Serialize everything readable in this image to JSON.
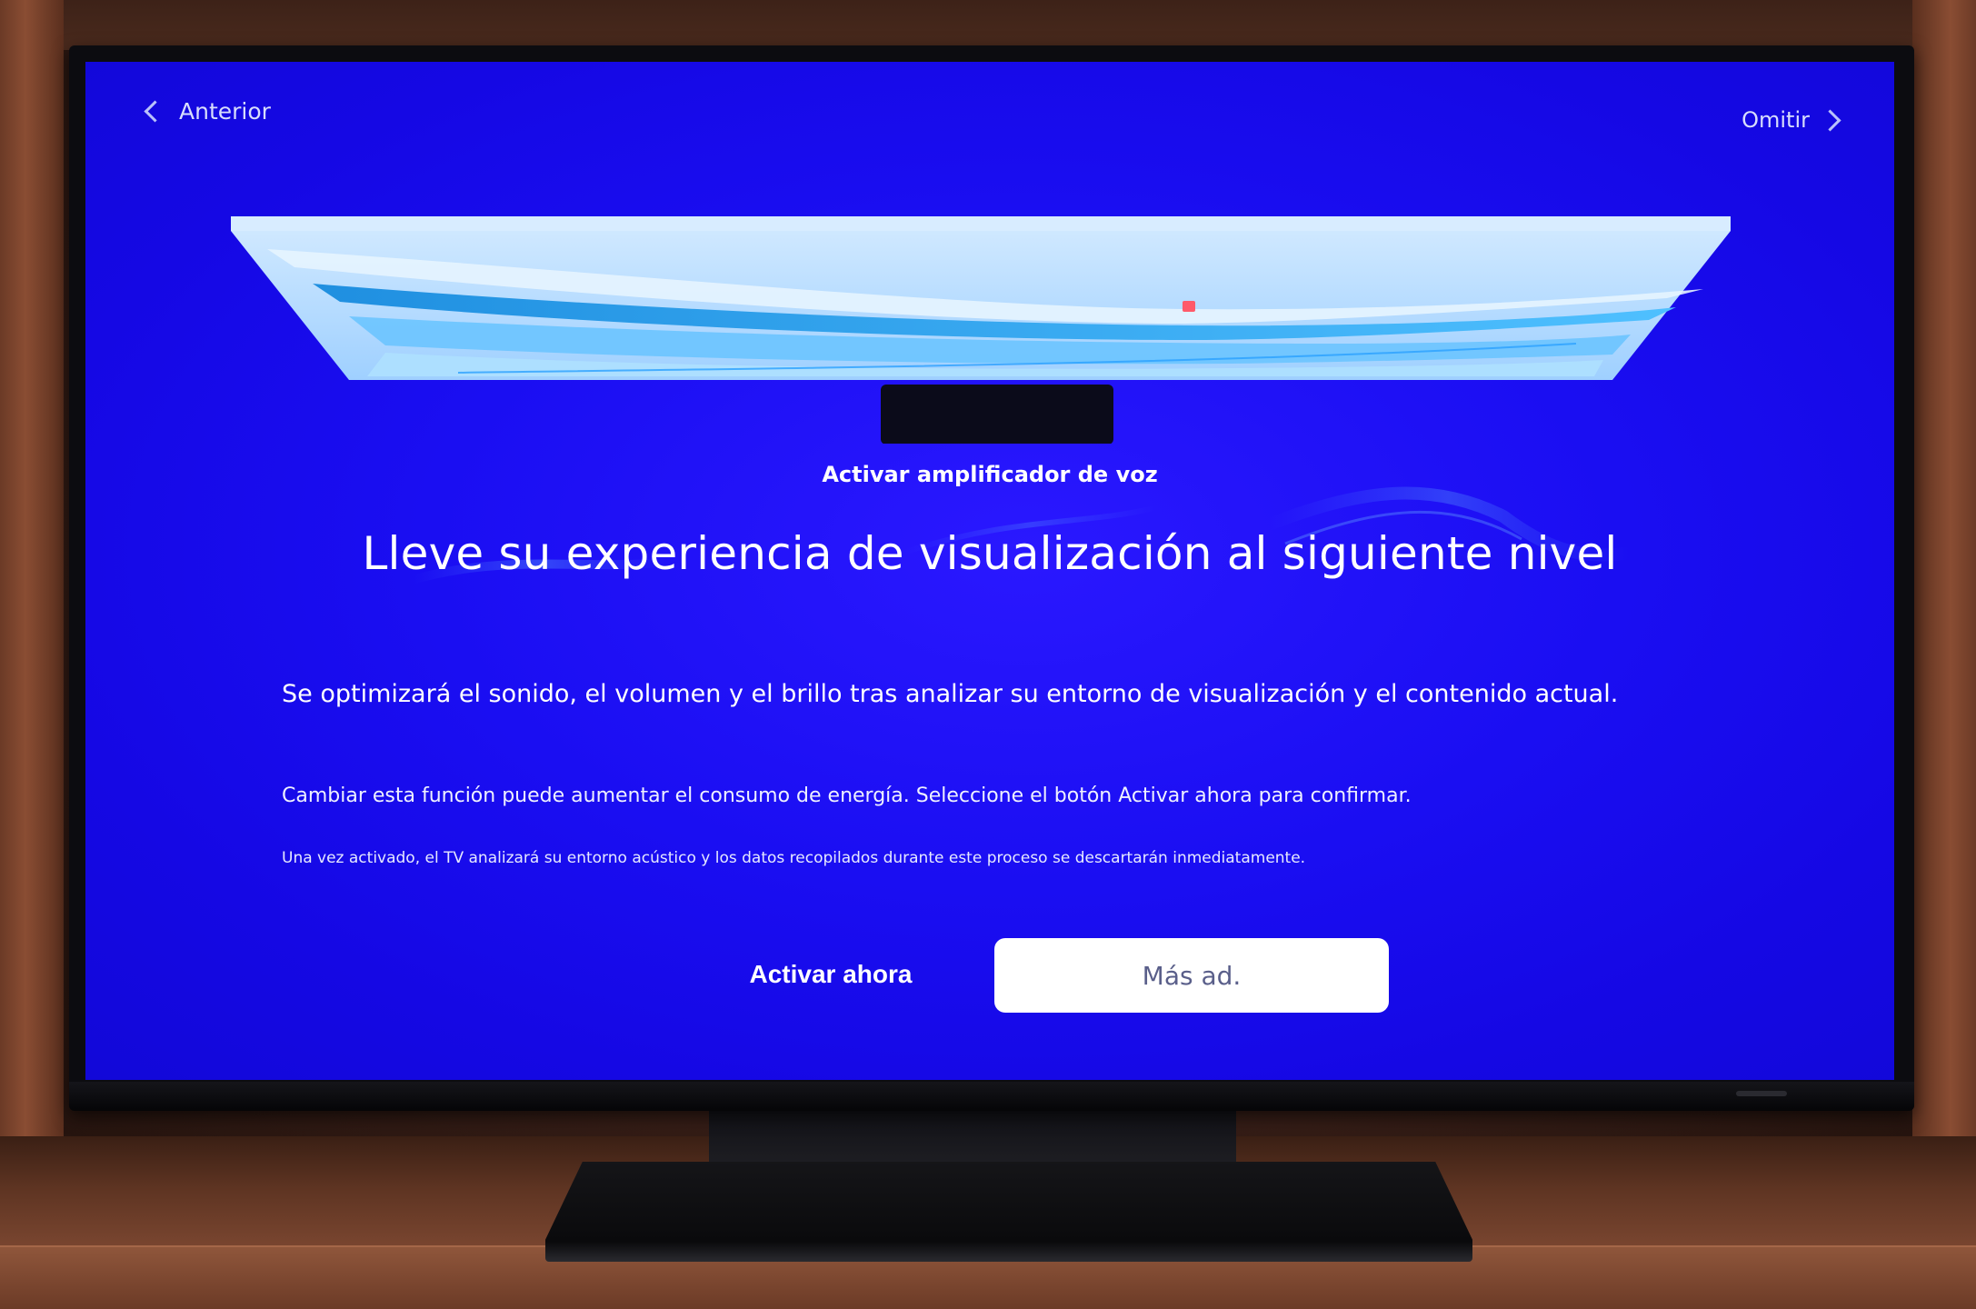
{
  "nav": {
    "back_label": "Anterior",
    "skip_label": "Omitir"
  },
  "hero": {
    "caption": "Activar amplificador de voz",
    "headline": "Lleve su experiencia de visualización al siguiente nivel"
  },
  "body": {
    "description": "Se optimizará el sonido, el volumen y el brillo tras analizar su entorno de visualización y el contenido actual.",
    "note": "Cambiar esta función puede aumentar el consumo de energía. Seleccione el botón Activar ahora para confirmar.",
    "small_note": "Una vez activado, el TV analizará su entorno acústico y los datos recopilados durante este proceso se descartarán inmediatamente."
  },
  "buttons": {
    "activate_label": "Activar ahora",
    "more_label": "Más ad."
  },
  "colors": {
    "screen_blue": "#1a0ef2",
    "button_bg": "#ffffff",
    "button_text": "#5a5f8a"
  }
}
